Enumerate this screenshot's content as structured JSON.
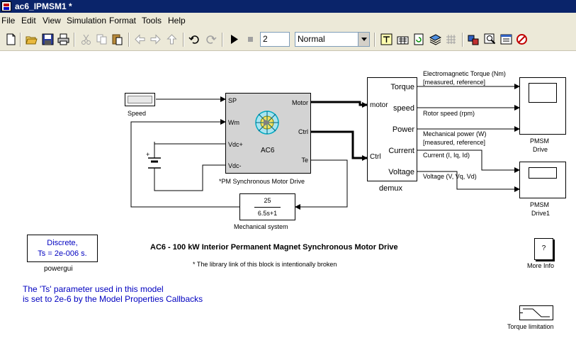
{
  "window": {
    "title": "ac6_IPMSM1 *"
  },
  "menu": [
    "File",
    "Edit",
    "View",
    "Simulation",
    "Format",
    "Tools",
    "Help"
  ],
  "toolbar": {
    "stop_time": "2",
    "sim_mode": "Normal",
    "icons": [
      "new-icon",
      "open-icon",
      "save-icon",
      "print-icon",
      "cut-icon",
      "copy-icon",
      "paste-icon",
      "back-icon",
      "forward-icon",
      "up-icon",
      "undo-icon",
      "redo-icon",
      "start-icon",
      "stop-icon",
      "update-diagram-icon",
      "build-icon",
      "refresh-icon",
      "library-browser-icon",
      "model-explorer-icon",
      "debugger-icon"
    ]
  },
  "diagram": {
    "speed_label": "Speed",
    "drive": {
      "ports_in": [
        "SP",
        "Wm",
        "Vdc+",
        "Vdc-"
      ],
      "ports_out": [
        "Motor",
        "Ctrl",
        "Te"
      ],
      "name": "AC6",
      "caption": "*PM Synchronous Motor Drive"
    },
    "mech": {
      "numerator": "25",
      "denominator": "6.5s+1",
      "caption": "Mechanical system"
    },
    "demux": {
      "inputs": [
        "motor",
        "Ctrl"
      ],
      "outputs": [
        "Torque",
        "speed",
        "Power",
        "Current",
        "Voltage"
      ],
      "caption": "demux"
    },
    "signals": {
      "torque_l1": "Electromagnetic Torque (Nm)",
      "torque_l2": "[measured, reference]",
      "speed": "Rotor speed (rpm)",
      "power_l1": "Mechanical power (W)",
      "power_l2": "[measured, reference]",
      "current": "Current (I, Iq, Id)",
      "voltage": "Voltage (V, Vq, Vd)"
    },
    "scope1": {
      "l1": "PMSM",
      "l2": "Drive"
    },
    "scope2": {
      "l1": "PMSM",
      "l2": "Drive1"
    },
    "powergui": {
      "l1": "Discrete,",
      "l2": "Ts = 2e-006 s.",
      "caption": "powergui"
    },
    "title": "AC6 - 100 kW Interior Permanent Magnet Synchronous Motor Drive",
    "note": "* The library link of this block is intentionally broken",
    "info": {
      "symbol": "?",
      "caption": "More Info"
    },
    "ts_note": {
      "l1": "The 'Ts' parameter used in this model",
      "l2": "is set to 2e-6  by the Model Properties Callbacks"
    },
    "torque_limit": "Torque limitation"
  },
  "colors": {
    "titlebar": "#0a246a",
    "toolbar": "#ece9d8",
    "block_gray": "#d3d3d3",
    "note_blue": "#0000c0"
  }
}
